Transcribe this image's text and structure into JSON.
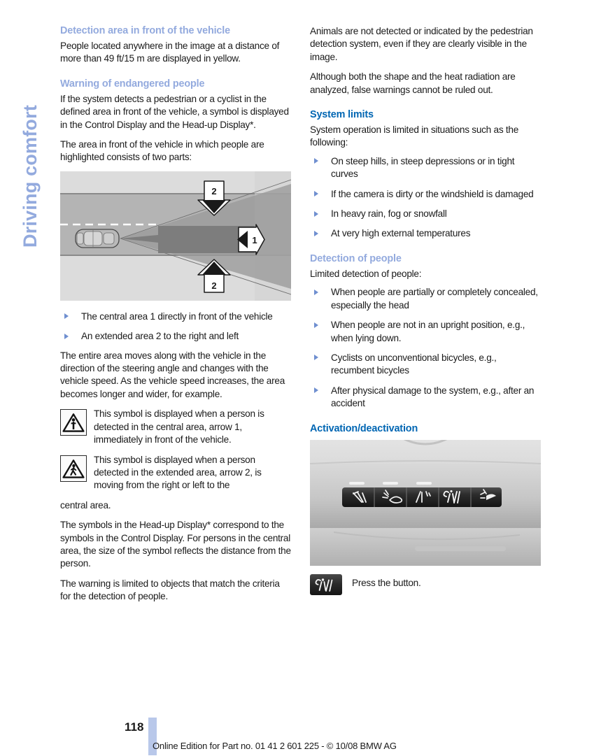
{
  "chapter": {
    "tab_label": "Driving comfort"
  },
  "left": {
    "heading_detection_area": "Detection area in front of the vehicle",
    "para_detection_area": "People located anywhere in the image at a distance of more than 49 ft/15 m are displayed in yellow.",
    "heading_warning": "Warning of endangered people",
    "para_warning_1": "If the system detects a pedestrian or a cyclist in the defined area in front of the vehicle, a symbol is displayed in the Control Display and the Head-up Display*.",
    "para_warning_2": "The area in front of the vehicle in which people are highlighted consists of two parts:",
    "figure_road": {
      "name": "detection-area-diagram",
      "callout_central": "1",
      "callout_extended_top": "2",
      "callout_extended_bottom": "2"
    },
    "bullets_areas": [
      "The central area 1 directly in front of the vehicle",
      "An extended area 2 to the right and left"
    ],
    "para_area_moves": "The entire area moves along with the vehicle in the direction of the steering angle and changes with the vehicle speed. As the vehicle speed increases, the area becomes longer and wider, for example.",
    "symbol_central": "This symbol is displayed when a person is detected in the central area, arrow 1, immediately in front of the vehicle.",
    "symbol_extended": "This symbol is displayed when a person detected in the extended area, arrow 2, is moving from the right or left to the",
    "symbol_extended_tail": "central area.",
    "para_hud": "The symbols in the Head-up Display* correspond to the symbols in the Control Display. For persons in the central area, the size of the symbol reflects the distance from the person.",
    "para_criteria": "The warning is limited to objects that match the criteria for the detection of people."
  },
  "right": {
    "para_animals": "Animals are not detected or indicated by the pedestrian detection system, even if they are clearly visible in the image.",
    "para_shape_heat": "Although both the shape and the heat radiation are analyzed, false warnings cannot be ruled out.",
    "heading_system_limits": "System limits",
    "para_system_limits": "System operation is limited in situations such as the following:",
    "bullets_system_limits": [
      "On steep hills, in steep depressions or in tight curves",
      "If the camera is dirty or the windshield is damaged",
      "In heavy rain, fog or snowfall",
      "At very high external temperatures"
    ],
    "heading_detection_people": "Detection of people",
    "para_detection_people": "Limited detection of people:",
    "bullets_detection_people": [
      "When people are partially or completely concealed, especially the head",
      "When people are not in an upright position, e.g., when lying down.",
      "Cyclists on unconventional bicycles, e.g., recumbent bicycles",
      "After physical damage to the system, e.g., after an accident"
    ],
    "heading_activation": "Activation/deactivation",
    "figure_console": {
      "name": "overhead-console-photo",
      "button_count": 5
    },
    "press_instruction": "Press the button."
  },
  "footer": {
    "page_number": "118",
    "note": "Online Edition for Part no. 01 41 2 601 225 - © 10/08 BMW AG"
  },
  "colors": {
    "heading_light": "#93aade",
    "heading_strong": "#0066b3",
    "bullet_marker": "#6f8fd0",
    "page_bar": "#b9c8ea",
    "text": "#1a1a1a"
  }
}
